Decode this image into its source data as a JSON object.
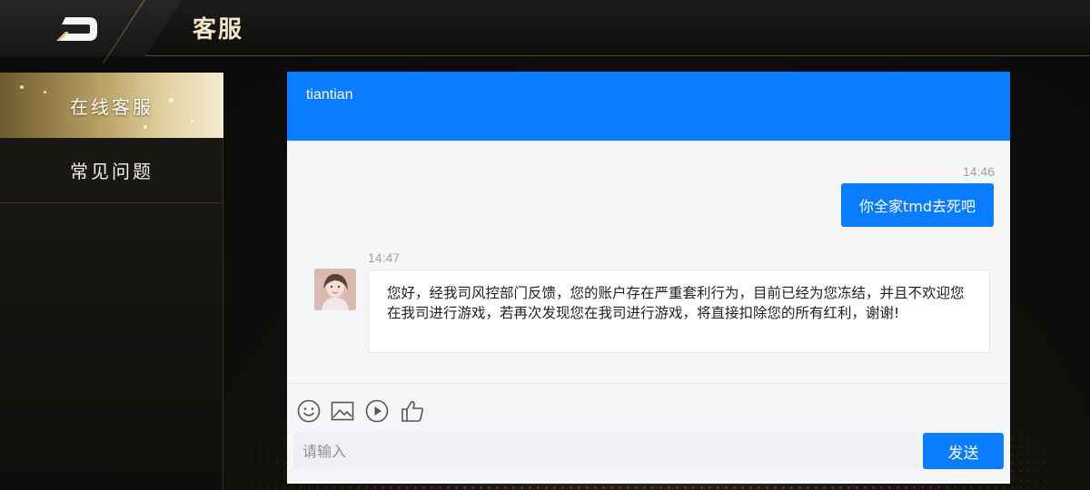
{
  "header": {
    "title": "客服",
    "logo_icon": "brand-logo-icon"
  },
  "sidebar": {
    "items": [
      {
        "label": "在线客服",
        "active": true
      },
      {
        "label": "常见问题",
        "active": false
      }
    ]
  },
  "chat": {
    "agent_name": "tiantian",
    "messages": [
      {
        "from": "user",
        "time": "14:46",
        "text": "你全家tmd去死吧"
      },
      {
        "from": "agent",
        "time": "14:47",
        "text": "您好，经我司风控部门反馈，您的账户存在严重套利行为，目前已经为您冻结，并且不欢迎您在我司进行游戏，若再次发现您在我司进行游戏，将直接扣除您的所有红利，谢谢!"
      }
    ],
    "toolbar_icons": [
      "emoji-icon",
      "image-icon",
      "video-icon",
      "thumbs-up-icon"
    ],
    "input": {
      "value": "",
      "placeholder": "请输入"
    },
    "send_label": "发送"
  },
  "colors": {
    "chat_blue": "#0a7cff",
    "gold_title": "#f2e6c8",
    "gold_accent": "#b9a064"
  }
}
